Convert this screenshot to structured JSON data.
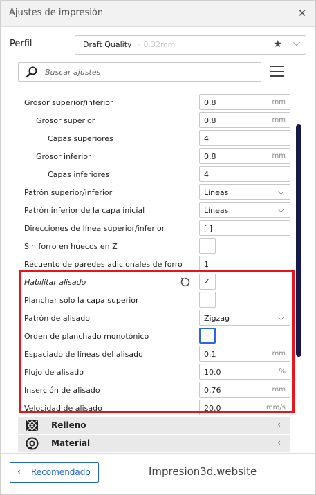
{
  "window": {
    "title": "Ajustes de impresión",
    "close_glyph": "✕"
  },
  "profile": {
    "label": "Perfil",
    "name": "Draft Quality",
    "detail": "- 0.32mm",
    "star_glyph": "★",
    "chevron_glyph": "⌵"
  },
  "search": {
    "placeholder": "Buscar ajustes"
  },
  "settings": [
    {
      "label": "Grosor superior/inferior",
      "value": "0.8",
      "unit": "mm"
    },
    {
      "label": "Grosor superior",
      "value": "0.8",
      "unit": "mm"
    },
    {
      "label": "Capas superiores",
      "value": "4",
      "unit": ""
    },
    {
      "label": "Grosor inferior",
      "value": "0.8",
      "unit": "mm"
    },
    {
      "label": "Capas inferiores",
      "value": "4",
      "unit": ""
    },
    {
      "label": "Patrón superior/inferior",
      "value": "Líneas"
    },
    {
      "label": "Patrón inferior de la capa inicial",
      "value": "Líneas"
    },
    {
      "label": "Direcciones de línea superior/inferior",
      "value": "[ ]",
      "unit": ""
    },
    {
      "label": "Sin forro en huecos en Z",
      "checked": false
    },
    {
      "label": "Recuento de paredes adicionales de forro",
      "value": "1",
      "unit": ""
    },
    {
      "label": "Habilitar alisado",
      "checked": true,
      "tick": "✓"
    },
    {
      "label": "Planchar solo la capa superior",
      "checked": false
    },
    {
      "label": "Patrón de alisado",
      "value": "Zigzag"
    },
    {
      "label": "Orden de planchado monotónico",
      "checked": false
    },
    {
      "label": "Espaciado de líneas del alisado",
      "value": "0.1",
      "unit": "mm"
    },
    {
      "label": "Flujo de alisado",
      "value": "10.0",
      "unit": "%"
    },
    {
      "label": "Inserción de alisado",
      "value": "0.76",
      "unit": "mm"
    },
    {
      "label": "Velocidad de alisado",
      "value": "20.0",
      "unit": "mm/s"
    }
  ],
  "dropdown_glyph": "⌵",
  "sections": [
    {
      "label": "Relleno",
      "chevron": "‹"
    },
    {
      "label": "Material",
      "chevron": "‹"
    }
  ],
  "footer": {
    "recommended_label": "Recomendado",
    "back_glyph": "‹",
    "watermark": "Impresion3d.website"
  },
  "colors": {
    "accent": "#2266c8",
    "highlight": "#e8141a",
    "scrollbar": "#16174a",
    "focus": "#2f66d8"
  }
}
